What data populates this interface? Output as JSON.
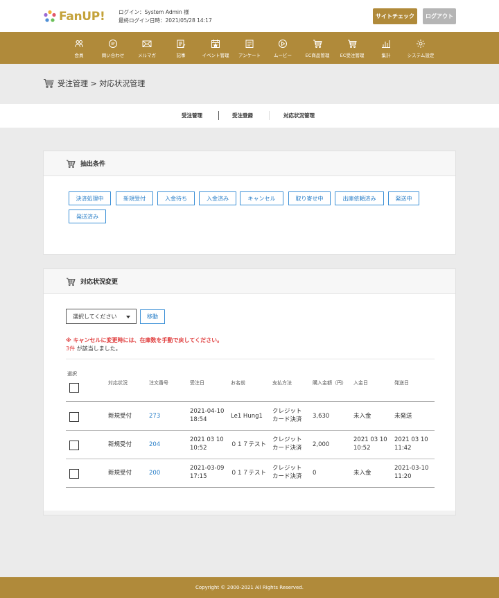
{
  "header": {
    "logo_text": "FanUP!",
    "login_line": "ログイン：System Admin 様",
    "last_login_line": "最終ログイン日時：2021/05/28 14:17",
    "site_check_label": "サイトチェック",
    "logout_label": "ログアウト",
    "accent_color": "#b08a3a"
  },
  "nav": {
    "items": [
      {
        "label": "会員",
        "icon": "people-icon"
      },
      {
        "label": "問い合わせ",
        "icon": "chat-icon"
      },
      {
        "label": "メルマガ",
        "icon": "mail-icon"
      },
      {
        "label": "記事",
        "icon": "edit-icon"
      },
      {
        "label": "イベント管理",
        "icon": "calendar-icon"
      },
      {
        "label": "アンケート",
        "icon": "survey-icon"
      },
      {
        "label": "ムービー",
        "icon": "play-icon"
      },
      {
        "label": "EC商品管理",
        "icon": "cart-icon"
      },
      {
        "label": "EC受注管理",
        "icon": "cart-icon"
      },
      {
        "label": "集計",
        "icon": "bar-chart-icon"
      },
      {
        "label": "システム設定",
        "icon": "gear-icon"
      }
    ]
  },
  "breadcrumb": {
    "text": "受注管理 > 対応状況管理"
  },
  "subnav": {
    "items": [
      "受注管理",
      "受注登録",
      "対応状況管理"
    ]
  },
  "filter_panel": {
    "title": "抽出条件",
    "tags": [
      "決済処理中",
      "新規受付",
      "入金待ち",
      "入金済み",
      "キャンセル",
      "取り寄せ中",
      "出庫依頼済み",
      "発送中",
      "発送済み"
    ]
  },
  "status_panel": {
    "title": "対応状況変更",
    "select_value": "選択してください",
    "move_label": "移動",
    "warning": "※ キャンセルに変更時には、在庫数を手動で戻してください。",
    "count_num": "3件",
    "count_text": "が該当しました。",
    "columns": [
      "選択",
      "対応状況",
      "注文番号",
      "受注日",
      "お名前",
      "支払方法",
      "購入金額（円）",
      "入金日",
      "発送日"
    ],
    "rows": [
      {
        "status": "新規受付",
        "order_no": "273",
        "order_date_1": "2021-04-10",
        "order_date_2": "18:54",
        "name": "Le1 Hung1",
        "payment_1": "クレジット",
        "payment_2": "カード決済",
        "amount": "3,630",
        "paid_1": "未入金",
        "paid_2": "",
        "shipped_1": "未発送",
        "shipped_2": ""
      },
      {
        "status": "新規受付",
        "order_no": "204",
        "order_date_1": "2021 03 10",
        "order_date_2": "10:52",
        "name": "０１７テスト",
        "payment_1": "クレジット",
        "payment_2": "カード決済",
        "amount": "2,000",
        "paid_1": "2021 03 10",
        "paid_2": "10:52",
        "shipped_1": "2021 03 10",
        "shipped_2": "11:42"
      },
      {
        "status": "新規受付",
        "order_no": "200",
        "order_date_1": "2021-03-09",
        "order_date_2": "17:15",
        "name": "０１７テスト",
        "payment_1": "クレジット",
        "payment_2": "カード決済",
        "amount": "0",
        "paid_1": "未入金",
        "paid_2": "",
        "shipped_1": "2021-03-10",
        "shipped_2": "11:20"
      }
    ]
  },
  "footer": {
    "copyright": "Copyright © 2000-2021 All Rights Reserved."
  }
}
